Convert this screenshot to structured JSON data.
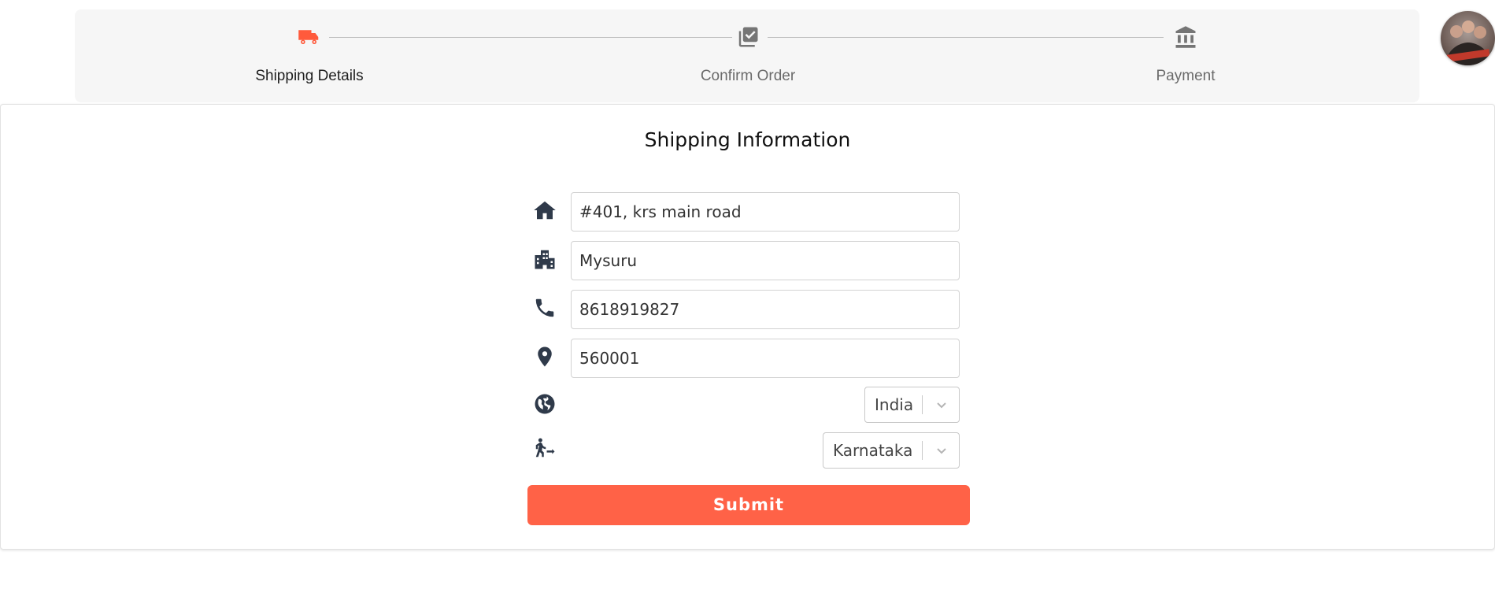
{
  "stepper": {
    "steps": [
      {
        "label": "Shipping Details",
        "icon": "truck-icon",
        "active": true
      },
      {
        "label": "Confirm Order",
        "icon": "checklist-icon",
        "active": false
      },
      {
        "label": "Payment",
        "icon": "bank-icon",
        "active": false
      }
    ],
    "active_color": "#ff5a3c",
    "inactive_color": "#757575"
  },
  "shipping_form": {
    "title": "Shipping Information",
    "address": {
      "value": "#401, krs main road",
      "icon": "home-icon"
    },
    "city": {
      "value": "Mysuru",
      "icon": "city-icon"
    },
    "phone": {
      "value": "8618919827",
      "icon": "phone-icon"
    },
    "pincode": {
      "value": "560001",
      "icon": "location-pin-icon"
    },
    "country": {
      "selected": "India",
      "icon": "globe-icon"
    },
    "state": {
      "selected": "Karnataka",
      "icon": "transfer-within-station-icon"
    },
    "submit_label": "Submit"
  },
  "colors": {
    "accent": "#ff6247",
    "icon": "#2f3a4a"
  }
}
